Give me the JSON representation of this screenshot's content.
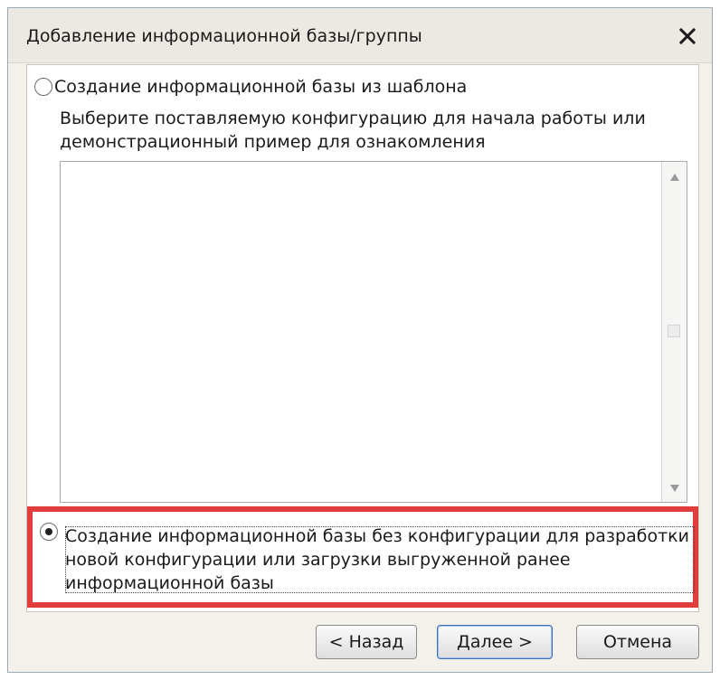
{
  "window": {
    "title": "Добавление информационной базы/группы",
    "close_icon": "close-icon"
  },
  "option_template": {
    "label": "Создание информационной базы из шаблона",
    "selected": false,
    "description_lines": [
      "Выберите поставляемую конфигурацию для начала работы или",
      "демонстрационный пример для ознакомления"
    ]
  },
  "template_list": {
    "items": [],
    "scroll_up_icon": "scroll-up-arrow-icon",
    "scroll_down_icon": "scroll-down-arrow-icon"
  },
  "option_empty": {
    "selected": true,
    "label_lines": [
      "Создание информационной базы без конфигурации для разработки",
      "новой конфигурации или загрузки выгруженной ранее",
      "информационной базы"
    ],
    "highlight_color": "#e23d3d"
  },
  "buttons": {
    "back": "< Назад",
    "next": "Далее >",
    "cancel": "Отмена"
  }
}
